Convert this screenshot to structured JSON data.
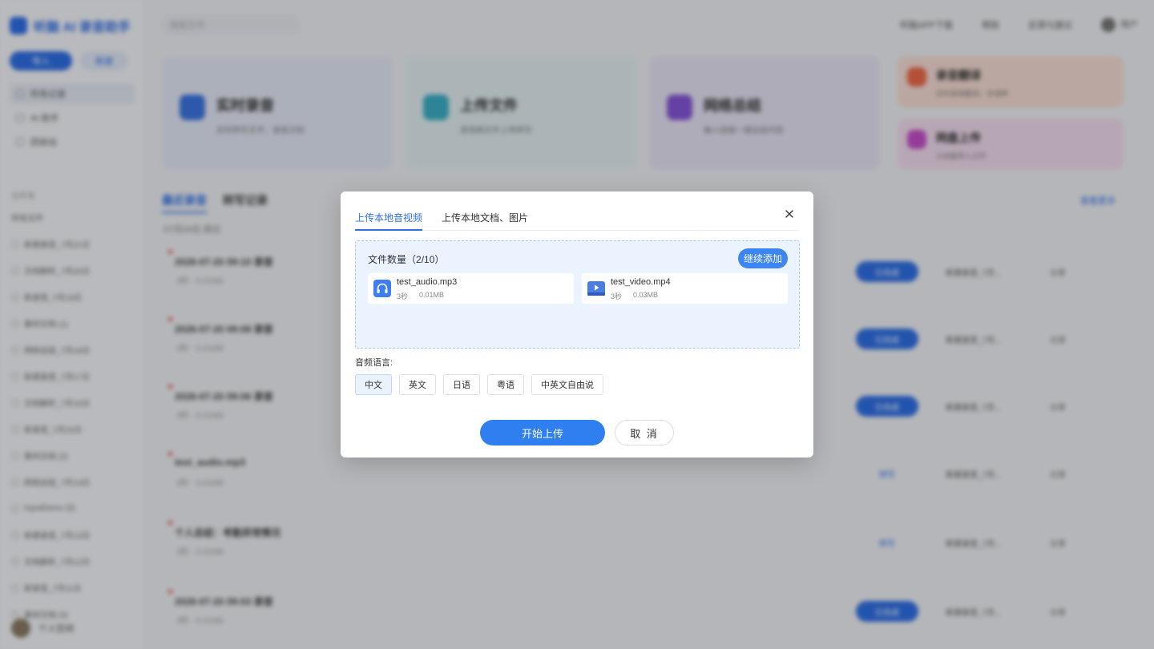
{
  "app": {
    "brand": "听脑 AI 录音助手",
    "sidebar": {
      "buttons": [
        "导入",
        "新建"
      ],
      "nav": [
        "所有记录",
        "AI 助手",
        "回收站"
      ],
      "section_label": "文件夹",
      "folder_label": "所有文件",
      "files": [
        "新建录音_7月21日",
        "文档解析_7月20日",
        "新录音_7月19日",
        "素材文档 (1)",
        "网络总结_7月18日",
        "新建录音_7月17日",
        "文档解析_7月16日",
        "新录音_7月15日",
        "素材文档 (2)",
        "网络总结_7月14日",
        "InputDemo (3)",
        "新建录音_7月13日",
        "文档解析_7月12日",
        "新录音_7月11日",
        "素材文档 (4)"
      ],
      "user": "个人空间"
    },
    "topbar": {
      "search_placeholder": "搜索文件",
      "links": [
        "听脑APP下载",
        "帮助",
        "反馈与建议"
      ],
      "user": "用户"
    },
    "cards": [
      {
        "title": "实时录音",
        "sub": "实时转写文字，语音识别"
      },
      {
        "title": "上传文件",
        "sub": "音视频文件上传转写"
      },
      {
        "title": "网络总结",
        "sub": "输入链接一键总结内容"
      }
    ],
    "mini_cards": [
      {
        "title": "录音翻译",
        "sub": "实时录音翻译，多语种"
      },
      {
        "title": "网盘上传",
        "sub": "从网盘导入文件"
      }
    ],
    "list_tabs": [
      "最近录音",
      "转写记录"
    ],
    "date_label": "07月20日 周日",
    "more_label": "查看更多",
    "records": [
      {
        "title": "2026-07-20 09:10 录音",
        "meta": "3秒 · 0.01MB",
        "badge": "已完成",
        "tag": "新建录音_7月...",
        "op": "分享"
      },
      {
        "title": "2026-07-20 09:08 录音",
        "meta": "3秒 · 0.01MB",
        "badge": "已完成",
        "tag": "新建录音_7月...",
        "op": "分享"
      },
      {
        "title": "2026-07-20 09:06 录音",
        "meta": "3秒 · 0.01MB",
        "badge": "已完成",
        "tag": "新建录音_7月...",
        "op": "分享"
      },
      {
        "title": "test_audio.mp3",
        "meta": "3秒 · 0.01MB",
        "badge": "转写",
        "tag": "新建录音_7月...",
        "op": "分享"
      },
      {
        "title": "个人总结：考勤异常情况",
        "meta": "3秒 · 0.01MB",
        "badge": "转写",
        "tag": "新建录音_7月...",
        "op": "分享"
      },
      {
        "title": "2026-07-20 09:03 录音",
        "meta": "3秒 · 0.01MB",
        "badge": "已完成",
        "tag": "新建录音_7月...",
        "op": "分享"
      }
    ]
  },
  "modal": {
    "tabs": [
      "上传本地音视频",
      "上传本地文档、图片"
    ],
    "file_count_label": "文件数量",
    "file_count_value": "（2/10）",
    "add_more_label": "继续添加",
    "files": [
      {
        "name": "test_audio.mp3",
        "duration": "3秒",
        "size": "0.01MB",
        "icon": "headphones-icon"
      },
      {
        "name": "test_video.mp4",
        "duration": "3秒",
        "size": "0.03MB",
        "icon": "video-play-icon"
      }
    ],
    "language_label": "音频语言:",
    "languages": [
      "中文",
      "英文",
      "日语",
      "粤语",
      "中英文自由说"
    ],
    "selected_language": "中文",
    "start_label": "开始上传",
    "cancel_label": "取 消"
  },
  "colors": {
    "accent": "#2f7ff0",
    "drop_zone_bg": "#ebf3fe",
    "audio_icon": "#3d7ff3",
    "video_icon": "#4a7ee0"
  }
}
